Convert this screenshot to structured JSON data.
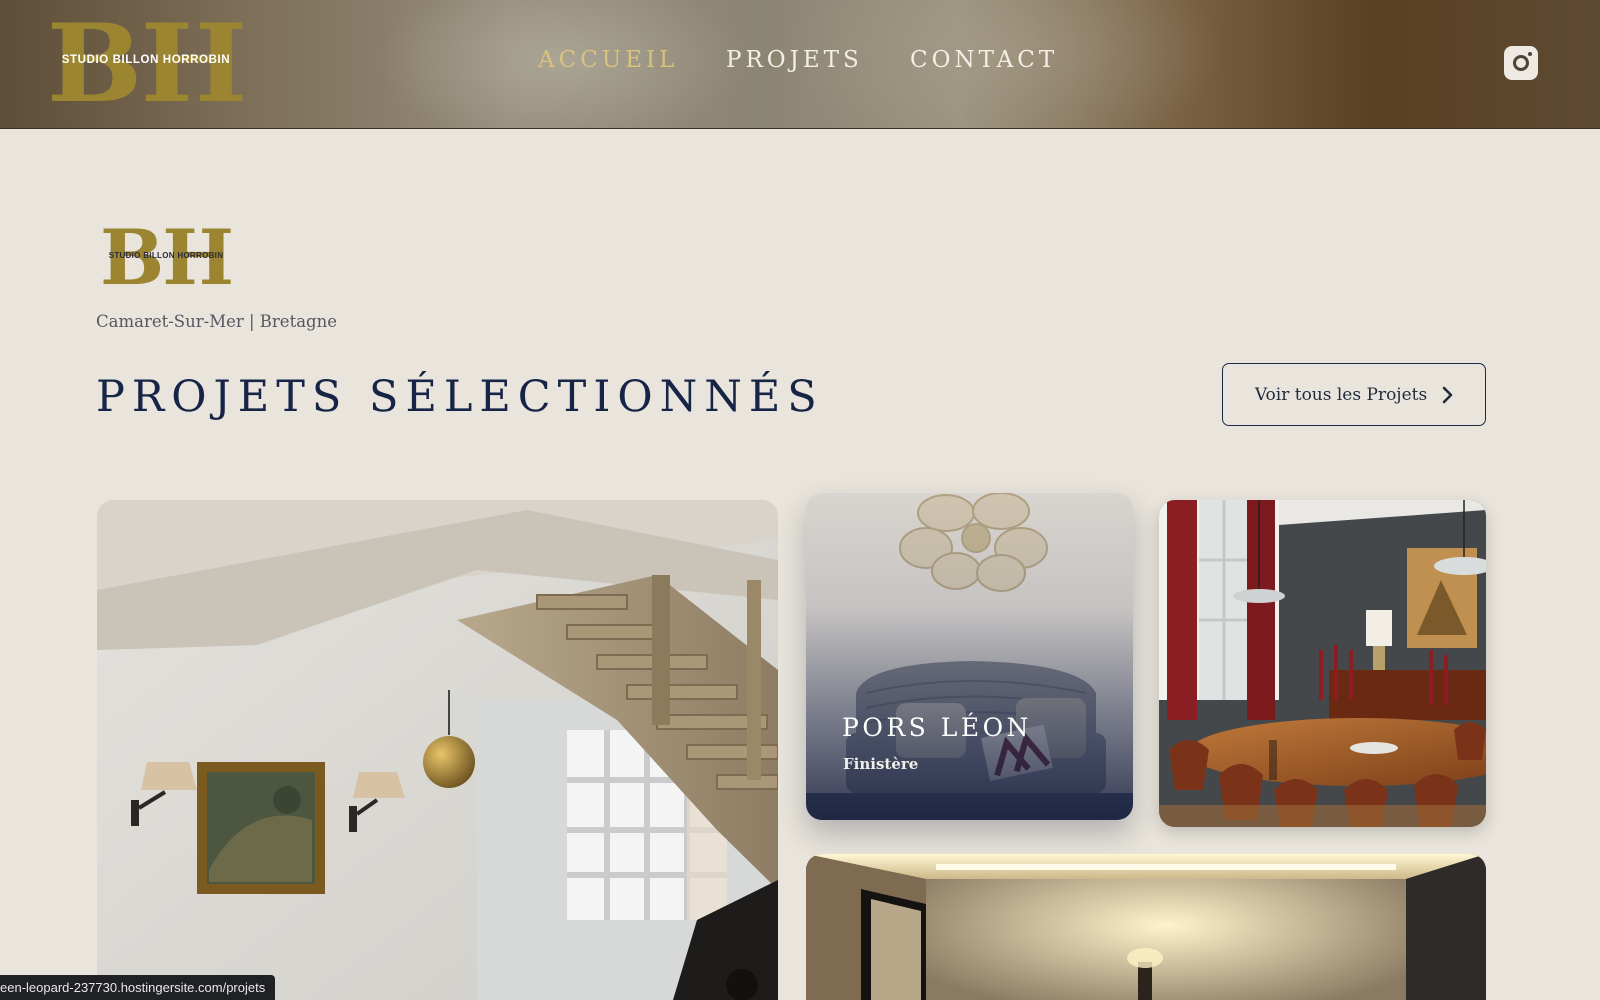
{
  "brand": {
    "monogram": "BH",
    "wordmark": "STUDIO BILLON HORROBIN",
    "gold": "#9c8530"
  },
  "nav": {
    "items": [
      {
        "label": "ACCUEIL",
        "active": true
      },
      {
        "label": "PROJETS",
        "active": false
      },
      {
        "label": "CONTACT",
        "active": false
      }
    ],
    "active_color": "#d9c27a",
    "instagram_icon": "instagram-icon"
  },
  "intro": {
    "location": "Camaret-Sur-Mer | Bretagne"
  },
  "projects": {
    "section_title": "PROJETS SÉLECTIONNÉS",
    "view_all_label": "Voir tous les Projets",
    "view_all_icon": "chevron-right-icon",
    "cards": [
      {
        "id": "staircase",
        "image": "wooden-staircase-interior"
      },
      {
        "id": "pors-leon",
        "image": "wicker-sofa-interior",
        "title": "PORS LÉON",
        "subtitle": "Finistère"
      },
      {
        "id": "dining",
        "image": "dining-room-interior"
      },
      {
        "id": "room",
        "image": "lit-room-interior"
      }
    ]
  },
  "status_bar": {
    "url": "een-leopard-237730.hostingersite.com/projets"
  },
  "colors": {
    "page_background": "#e9e5dc",
    "heading": "#162446"
  }
}
